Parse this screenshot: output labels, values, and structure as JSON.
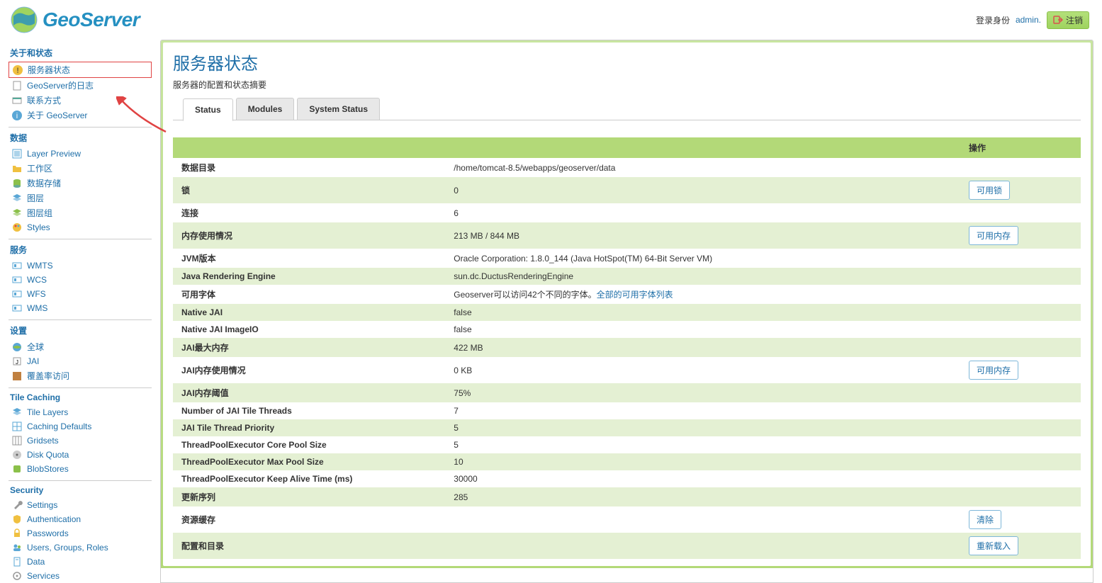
{
  "header": {
    "logo_text": "GeoServer",
    "login_as_label": "登录身份",
    "login_user": "admin.",
    "logout_label": "注销"
  },
  "sidebar": {
    "groups": [
      {
        "title": "关于和状态",
        "first": true,
        "items": [
          {
            "icon": "warn",
            "label": "服务器状态",
            "highlighted": true
          },
          {
            "icon": "doc",
            "label": "GeoServer的日志"
          },
          {
            "icon": "card",
            "label": "联系方式"
          },
          {
            "icon": "info",
            "label": "关于 GeoServer"
          }
        ]
      },
      {
        "title": "数据",
        "items": [
          {
            "icon": "layer",
            "label": "Layer Preview"
          },
          {
            "icon": "folder",
            "label": "工作区"
          },
          {
            "icon": "db",
            "label": "数据存储"
          },
          {
            "icon": "stack",
            "label": "图层"
          },
          {
            "icon": "stackg",
            "label": "图层组"
          },
          {
            "icon": "palette",
            "label": "Styles"
          }
        ]
      },
      {
        "title": "服务",
        "items": [
          {
            "icon": "svc",
            "label": "WMTS"
          },
          {
            "icon": "svc",
            "label": "WCS"
          },
          {
            "icon": "svc",
            "label": "WFS"
          },
          {
            "icon": "svc",
            "label": "WMS"
          }
        ]
      },
      {
        "title": "设置",
        "items": [
          {
            "icon": "globe",
            "label": "全球"
          },
          {
            "icon": "jai",
            "label": "JAI"
          },
          {
            "icon": "cover",
            "label": "覆盖率访问"
          }
        ]
      },
      {
        "title": "Tile Caching",
        "items": [
          {
            "icon": "stack",
            "label": "Tile Layers"
          },
          {
            "icon": "grid",
            "label": "Caching Defaults"
          },
          {
            "icon": "grid2",
            "label": "Gridsets"
          },
          {
            "icon": "disk",
            "label": "Disk Quota"
          },
          {
            "icon": "blob",
            "label": "BlobStores"
          }
        ]
      },
      {
        "title": "Security",
        "items": [
          {
            "icon": "wrench",
            "label": "Settings"
          },
          {
            "icon": "shield",
            "label": "Authentication"
          },
          {
            "icon": "lock",
            "label": "Passwords"
          },
          {
            "icon": "users",
            "label": "Users, Groups, Roles"
          },
          {
            "icon": "data",
            "label": "Data"
          },
          {
            "icon": "svc2",
            "label": "Services"
          }
        ]
      }
    ]
  },
  "main": {
    "title": "服务器状态",
    "desc": "服务器的配置和状态摘要",
    "tabs": [
      "Status",
      "Modules",
      "System Status"
    ],
    "active_tab": 0,
    "table": {
      "header_action": "操作",
      "rows": [
        {
          "label": "数据目录",
          "value": "/home/tomcat-8.5/webapps/geoserver/data",
          "action": "",
          "even": false
        },
        {
          "label": "锁",
          "value": "0",
          "action": "可用锁",
          "even": true
        },
        {
          "label": "连接",
          "value": "6",
          "action": "",
          "even": false
        },
        {
          "label": "内存使用情况",
          "value": "213 MB / 844 MB",
          "action": "可用内存",
          "even": true
        },
        {
          "label": "JVM版本",
          "value": "Oracle Corporation: 1.8.0_144 (Java HotSpot(TM) 64-Bit Server VM)",
          "action": "",
          "even": false
        },
        {
          "label": "Java Rendering Engine",
          "value": "sun.dc.DuctusRenderingEngine",
          "action": "",
          "even": true
        },
        {
          "label": "可用字体",
          "value_prefix": "Geoserver可以访问42个不同的字体。",
          "link_text": "全部的可用字体列表",
          "action": "",
          "even": false,
          "has_link": true
        },
        {
          "label": "Native JAI",
          "value": "false",
          "action": "",
          "even": true
        },
        {
          "label": "Native JAI ImageIO",
          "value": "false",
          "action": "",
          "even": false
        },
        {
          "label": "JAI最大内存",
          "value": "422 MB",
          "action": "",
          "even": true
        },
        {
          "label": "JAI内存使用情况",
          "value": "0 KB",
          "action": "可用内存",
          "even": false
        },
        {
          "label": "JAI内存阈值",
          "value": "75%",
          "action": "",
          "even": true
        },
        {
          "label": "Number of JAI Tile Threads",
          "value": "7",
          "action": "",
          "even": false
        },
        {
          "label": "JAI Tile Thread Priority",
          "value": "5",
          "action": "",
          "even": true
        },
        {
          "label": "ThreadPoolExecutor Core Pool Size",
          "value": "5",
          "action": "",
          "even": false
        },
        {
          "label": "ThreadPoolExecutor Max Pool Size",
          "value": "10",
          "action": "",
          "even": true
        },
        {
          "label": "ThreadPoolExecutor Keep Alive Time (ms)",
          "value": "30000",
          "action": "",
          "even": false
        },
        {
          "label": "更新序列",
          "value": "285",
          "action": "",
          "even": true
        },
        {
          "label": "资源缓存",
          "value": "",
          "action": "清除",
          "even": false
        },
        {
          "label": "配置和目录",
          "value": "",
          "action": "重新载入",
          "even": true
        }
      ]
    }
  }
}
